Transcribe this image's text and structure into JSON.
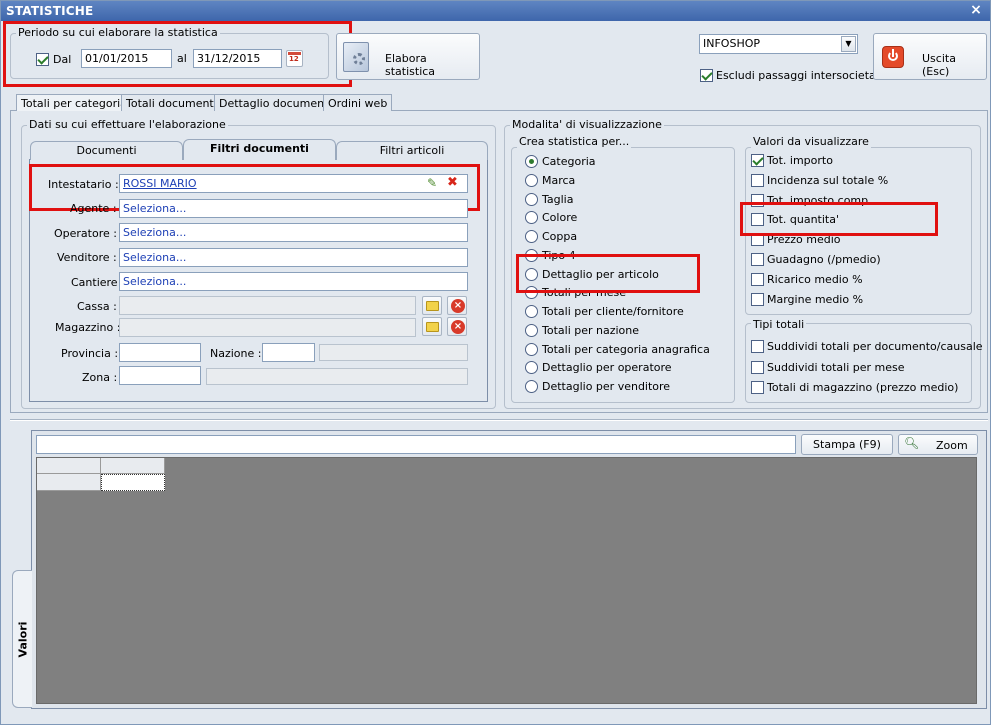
{
  "window": {
    "title": "STATISTICHE",
    "close": "×"
  },
  "period": {
    "group_label": "Periodo su cui elaborare la statistica",
    "dal_checked": true,
    "dal_label": "Dal",
    "date_from": "01/01/2015",
    "al_label": "al",
    "date_to": "31/12/2015",
    "calendar_icon": "12"
  },
  "elabora_button": "Elabora statistica",
  "company": {
    "selected": "INFOSHOP",
    "exclude_label": "Escludi passaggi intersocietari",
    "exclude_checked": true
  },
  "exit_button": "Uscita (Esc)",
  "main_tabs": [
    "Totali per categoria",
    "Totali documenti",
    "Dettaglio documenti",
    "Ordini web"
  ],
  "filters": {
    "group_label": "Dati su cui effettuare l'elaborazione",
    "tabs": [
      "Documenti",
      "Filtri documenti",
      "Filtri articoli"
    ],
    "rows": {
      "intestatario_label": "Intestatario :",
      "intestatario_value": "ROSSI MARIO",
      "agente_label": "Agente :",
      "agente_value": "Seleziona...",
      "operatore_label": "Operatore :",
      "operatore_value": "Seleziona...",
      "venditore_label": "Venditore :",
      "venditore_value": "Seleziona...",
      "cantiere_label": "Cantiere",
      "cantiere_value": "Seleziona...",
      "cassa_label": "Cassa :",
      "magazzino_label": "Magazzino :",
      "provincia_label": "Provincia :",
      "nazione_label": "Nazione :",
      "zona_label": "Zona :"
    }
  },
  "mode": {
    "group_label": "Modalita' di visualizzazione",
    "create_label": "Crea statistica per...",
    "options": [
      "Categoria",
      "Marca",
      "Taglia",
      "Colore",
      "Coppa",
      "Tipo 4",
      "Dettaglio per articolo",
      "Totali per mese",
      "Totali per cliente/fornitore",
      "Totali per nazione",
      "Totali per categoria anagrafica",
      "Dettaglio per operatore",
      "Dettaglio per venditore"
    ],
    "selected_index": 0,
    "values_label": "Valori da visualizzare",
    "values": [
      "Tot. importo",
      "Incidenza sul totale %",
      "Tot. imposto comp.",
      "Tot. quantita'",
      "Prezzo medio",
      "Guadagno (/pmedio)",
      "Ricarico medio %",
      "Margine medio %"
    ],
    "values_checked": [
      true,
      false,
      false,
      false,
      false,
      false,
      false,
      false
    ],
    "totals_label": "Tipi totali",
    "totals": [
      "Suddividi totali per documento/causale",
      "Suddividi totali per mese",
      "Totali di magazzino (prezzo medio)"
    ]
  },
  "bottom": {
    "print_button": "Stampa (F9)",
    "zoom_button": "Zoom",
    "side_tab": "Valori"
  }
}
